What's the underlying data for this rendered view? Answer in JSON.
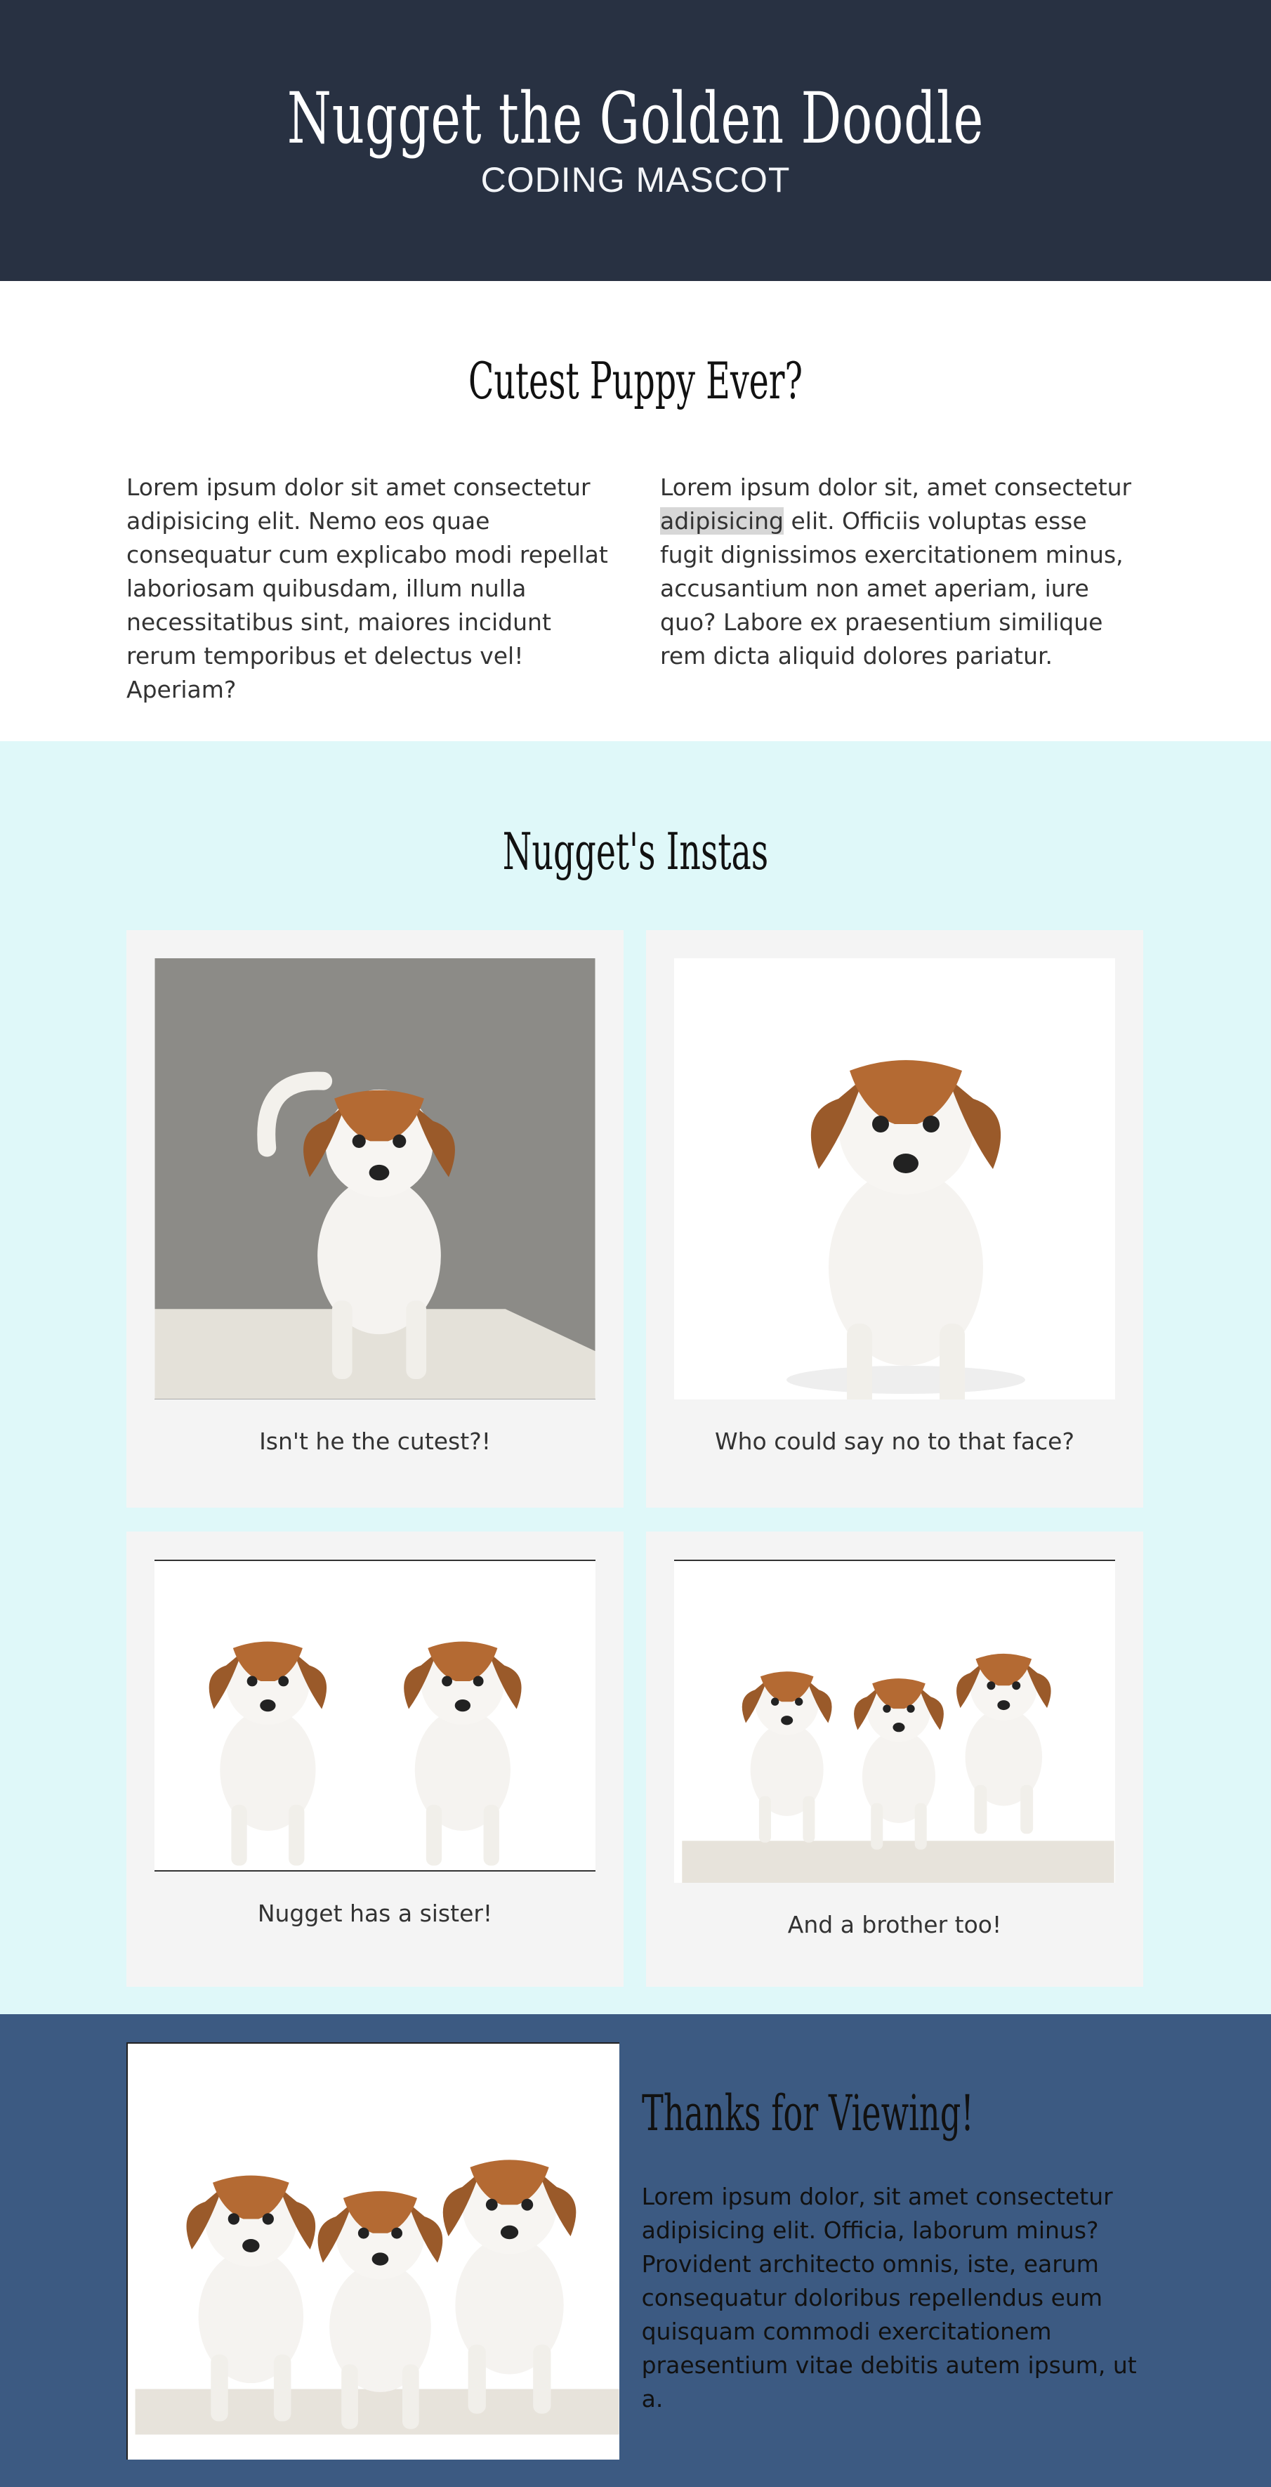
{
  "header": {
    "title": "Nugget the Golden Doodle",
    "subtitle": "CODING MASCOT"
  },
  "intro": {
    "heading": "Cutest Puppy Ever?",
    "col1": "Lorem ipsum dolor sit amet consectetur adipisicing elit. Nemo eos quae consequatur cum explicabo modi repellat laboriosam quibusdam, illum nulla necessitatibus sint, maiores incidunt rerum temporibus et delectus vel! Aperiam?",
    "col2_before": "Lorem ipsum dolor sit, amet consectetur ",
    "col2_highlight": "adipisicing",
    "col2_after": " elit. Officiis voluptas esse fugit dignissimos exercitationem minus, accusantium non amet aperiam, iure quo? Labore ex praesentium similique rem dicta aliquid dolores pariatur."
  },
  "instas": {
    "heading": "Nugget's Instas",
    "cards": [
      {
        "caption": "Isn't he the cutest?!"
      },
      {
        "caption": "Who could say no to that face?"
      },
      {
        "caption": "Nugget has a sister!"
      },
      {
        "caption": "And a brother too!"
      }
    ]
  },
  "footer": {
    "heading": "Thanks for Viewing!",
    "body": "Lorem ipsum dolor, sit amet consectetur adipisicing elit. Officia, laborum minus? Provident architecto omnis, iste, earum consequatur doloribus repellendus eum quisquam commodi exercitationem praesentium vitae debitis autem ipsum, ut a."
  },
  "colors": {
    "header_bg": "#283142",
    "instas_bg": "#dff8f9",
    "footer_bg": "#3c5a82",
    "card_bg": "#f4f4f4"
  }
}
